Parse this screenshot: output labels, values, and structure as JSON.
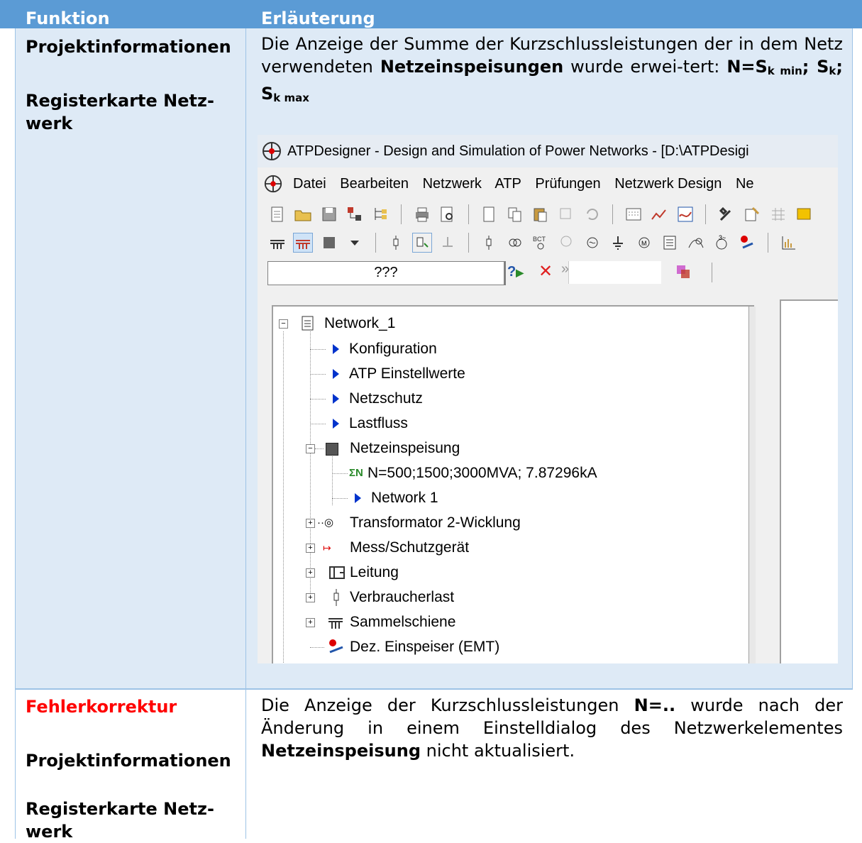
{
  "table": {
    "headers": {
      "function": "Funktion",
      "explanation": "Erläuterung"
    },
    "row1": {
      "label_main": "Projektinformationen",
      "label_tab_1": "Registerkarte Netz-",
      "label_tab_2": "werk",
      "text_intro": "Die Anzeige der Summe der Kurzschlussleistungen der in dem Netz verwendeten",
      "text_bold": "Netzeinspeisungen",
      "text_after": "wurde erwei-tert:",
      "formula_n": "N=S",
      "formula_sub1": "k min",
      "formula_sep1": "; S",
      "formula_sub2": "k",
      "formula_sep2": "; S",
      "formula_sub3": "k max"
    },
    "row2": {
      "label_fix": "Fehlerkorrektur",
      "label_main": "Projektinformationen",
      "label_tab_1": "Registerkarte Netz-",
      "label_tab_2": "werk",
      "text_pre": "Die Anzeige der Kurzschlussleistungen",
      "text_bold1": "N=..",
      "text_mid": "wurde nach der Änderung in einem Einstelldialog des Netzwerkelementes",
      "text_bold2": "Netzeinspeisung",
      "text_post": "nicht aktualisiert."
    }
  },
  "screenshot": {
    "title": "ATPDesigner - Design and Simulation of Power Networks - [D:\\ATPDesigi",
    "menu": [
      "Datei",
      "Bearbeiten",
      "Netzwerk",
      "ATP",
      "Prüfungen",
      "Netzwerk Design",
      "Ne"
    ],
    "combo_value": "???",
    "tree": {
      "root": "Network_1",
      "items": [
        "Konfiguration",
        "ATP Einstellwerte",
        "Netzschutz",
        "Lastfluss"
      ],
      "feed": "Netzeinspeisung",
      "feed_summary_icon": "ΣN",
      "feed_summary": "N=500;1500;3000MVA; 7.87296kA",
      "feed_child": "Network 1",
      "groups": [
        "Transformator 2-Wicklung",
        "Mess/Schutzgerät",
        "Leitung",
        "Verbraucherlast",
        "Sammelschiene",
        "Dez. Einspeiser (EMT)"
      ]
    }
  },
  "colors": {
    "header": "#5b9bd5",
    "row_fill": "#deeaf6",
    "accent_red": "#ff0000"
  }
}
